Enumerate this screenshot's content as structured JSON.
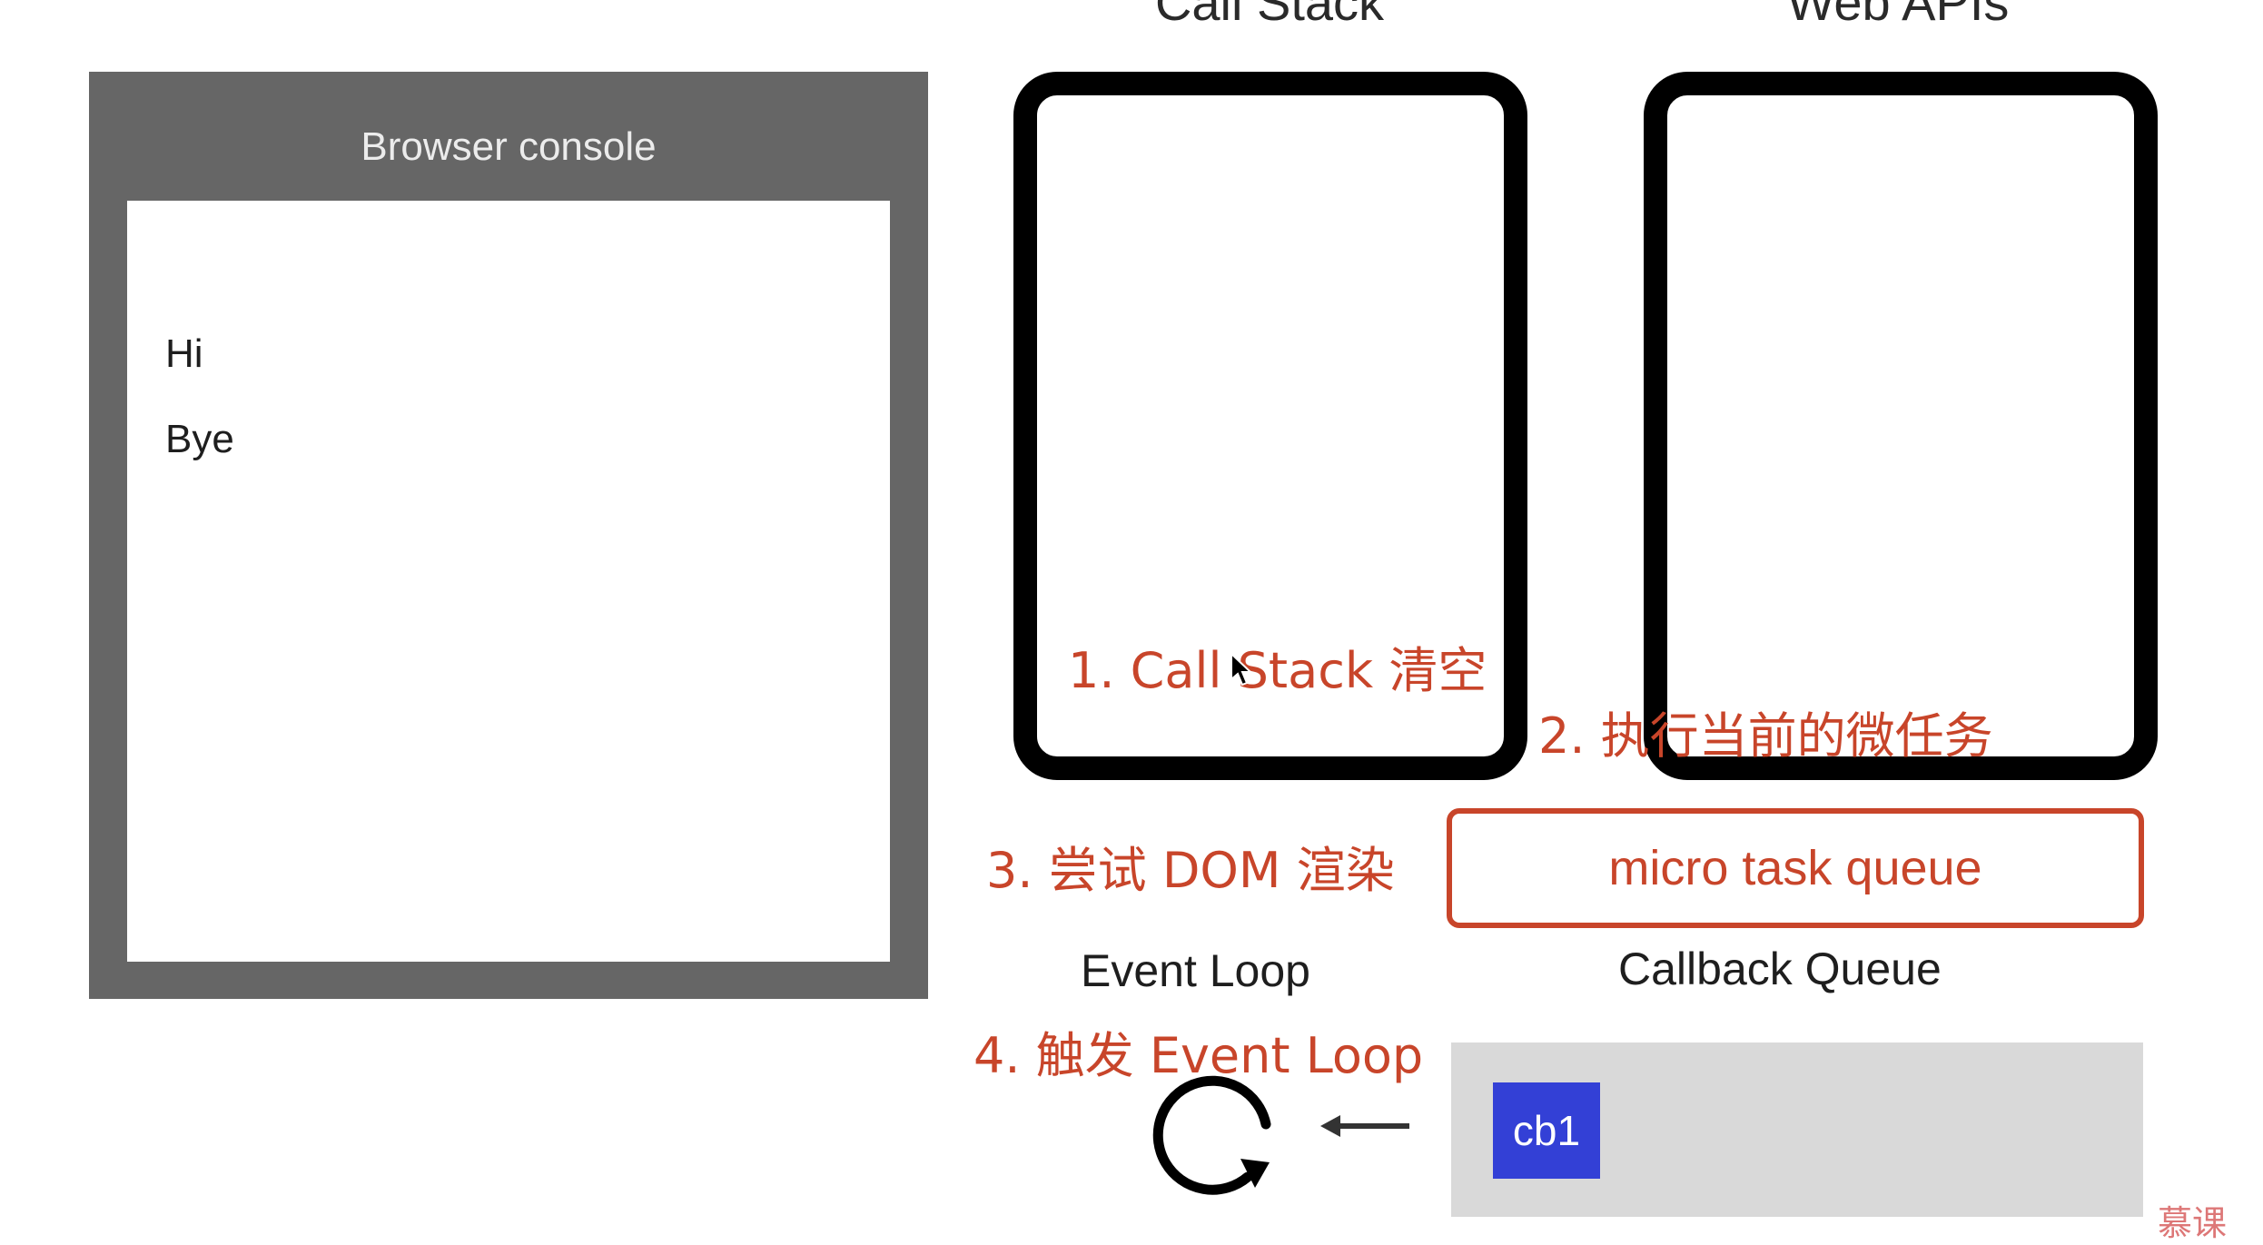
{
  "console": {
    "title": "Browser console",
    "lines": [
      "Hi",
      "Bye"
    ]
  },
  "columns": {
    "call_stack_title": "Call Stack",
    "web_apis_title": "Web APIs"
  },
  "annotations": {
    "step1": "1. Call Stack 清空",
    "step2": "2. 执行当前的微任务",
    "step3": "3. 尝试 DOM 渲染",
    "step4": "4. 触发 Event Loop"
  },
  "micro_task_queue_label": "micro task queue",
  "labels": {
    "event_loop": "Event Loop",
    "callback_queue": "Callback Queue"
  },
  "callback_queue": {
    "items": [
      "cb1"
    ]
  },
  "watermark": "慕课",
  "colors": {
    "annotation": "#c8452a",
    "console_frame": "#666666",
    "callback_item": "#3340d6",
    "callback_queue_bg": "#d9d9d9"
  },
  "icons": {
    "loop": "refresh-loop-icon",
    "arrow": "left-arrow-icon",
    "cursor": "mouse-pointer-icon"
  }
}
